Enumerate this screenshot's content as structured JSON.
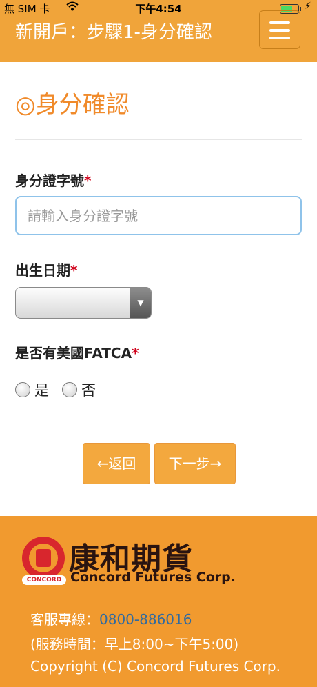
{
  "status_bar": {
    "carrier": "無 SIM 卡",
    "time": "下午4:54",
    "wifi_icon": "wifi-icon",
    "battery_icon": "battery-icon",
    "charging_icon": "charging-bolt-icon"
  },
  "header": {
    "title": "新開戶：步驟1-身分確認",
    "menu_icon": "hamburger-menu-icon"
  },
  "section": {
    "title": "◎身分確認"
  },
  "form": {
    "id_label": "身分證字號",
    "id_placeholder": "請輸入身分證字號",
    "id_value": "",
    "birth_label": "出生日期",
    "birth_value": "",
    "fatca_label": "是否有美國FATCA",
    "required_mark": "*",
    "fatca_options": [
      "是",
      "否"
    ]
  },
  "buttons": {
    "back": "←返回",
    "next": "下一步→"
  },
  "footer": {
    "logo_cn": "康和期貨",
    "logo_en": "Concord Futures Corp.",
    "logo_small": "CONCORD",
    "hotline_label": "客服專線：",
    "hotline_number": "0800-886016",
    "hours": "(服務時間：早上8:00~下午5:00)",
    "copyright": "Copyright (C) Concord Futures Corp."
  },
  "colors": {
    "brand_orange": "#f0a43a",
    "title_orange": "#f08a2a",
    "required_red": "#d0021b",
    "link_blue": "#2f6aa0"
  }
}
